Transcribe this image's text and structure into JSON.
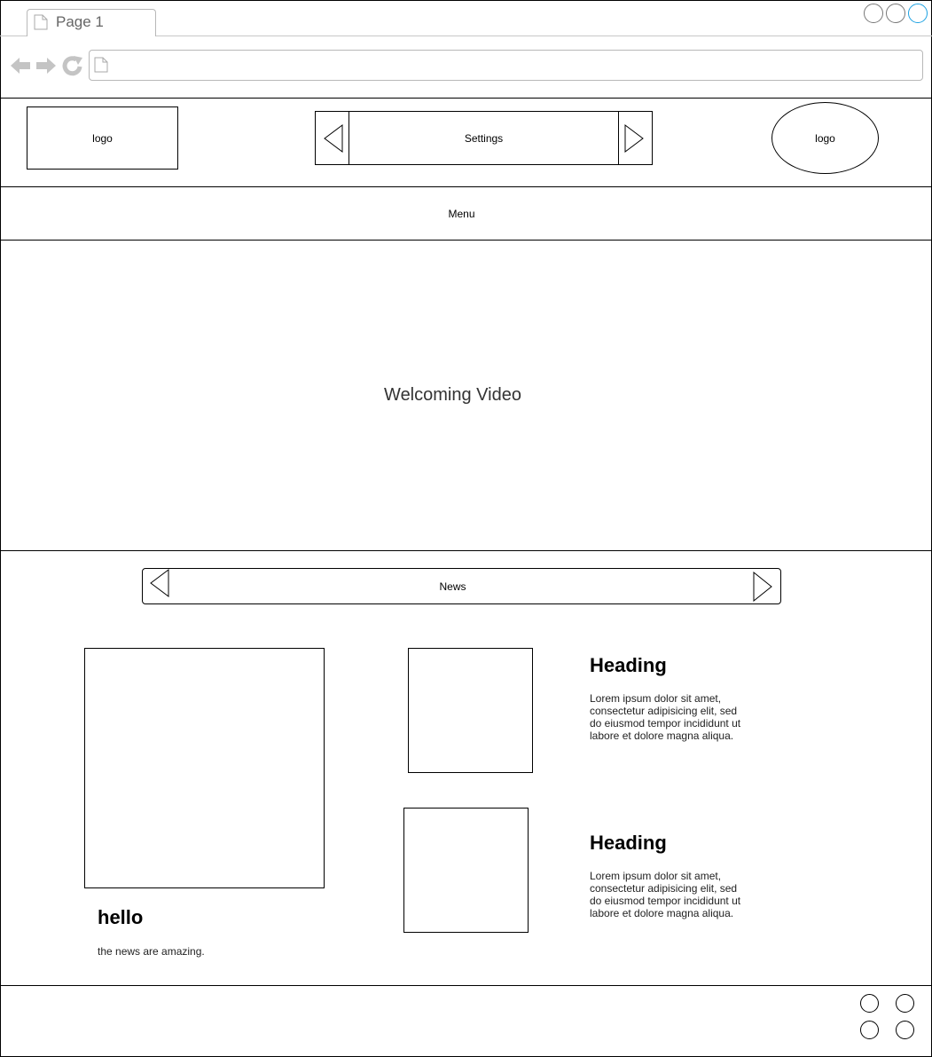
{
  "browser": {
    "tab_title": "Page 1",
    "address": "",
    "accent_color": "#1ba1e2"
  },
  "header": {
    "logo_left": "logo",
    "settings_label": "Settings",
    "logo_right": "logo"
  },
  "menu": {
    "label": "Menu"
  },
  "video": {
    "label": "Welcoming Video"
  },
  "news": {
    "label": "News",
    "main": {
      "heading": "hello",
      "text": "the news are amazing."
    },
    "items": [
      {
        "heading": "Heading",
        "body": "Lorem ipsum dolor sit amet, consectetur adipisicing elit, sed do eiusmod tempor incididunt ut labore et dolore magna aliqua."
      },
      {
        "heading": "Heading",
        "body": "Lorem ipsum dolor sit amet, consectetur adipisicing elit, sed do eiusmod tempor incididunt ut labore et dolore magna aliqua."
      }
    ]
  },
  "icons": {
    "tab": "page-icon",
    "back": "arrow-left-icon",
    "forward": "arrow-right-icon",
    "reload": "reload-icon",
    "address": "page-icon",
    "prev": "triangle-left-icon",
    "next": "triangle-right-icon"
  }
}
